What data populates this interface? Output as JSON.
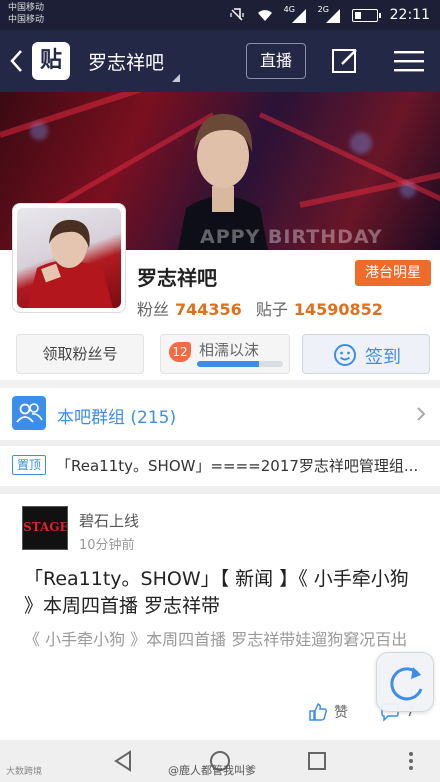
{
  "status_bar": {
    "carrier_line1": "中国移动",
    "carrier_line2": "中国移动",
    "network_1": "4G",
    "network_2": "2G",
    "time": "22:11",
    "battery_level": 0.3
  },
  "nav": {
    "logo_text": "贴",
    "forum_title": "罗志祥吧",
    "live_label": "直播"
  },
  "banner": {
    "overlay_text": "APPY BIRTHDAY"
  },
  "forum": {
    "name": "罗志祥吧",
    "category": "港台明星",
    "fans_label": "粉丝",
    "fans_count": "744356",
    "posts_label": "贴子",
    "posts_count": "14590852"
  },
  "actions": {
    "fans_badge_label": "领取粉丝号",
    "level_number": "12",
    "level_name": "相濡以沫",
    "level_progress": 0.72,
    "sign_label": "签到"
  },
  "group": {
    "label": "本吧群组 (215)"
  },
  "pinned": {
    "badge": "置顶",
    "title": "「Rea11ty。SHOW」====2017罗志祥吧管理组..."
  },
  "post": {
    "avatar_text": "STAGE",
    "author": "碧石上线",
    "time": "10分钟前",
    "title": "「Rea11ty。SHOW」【 新闻 】《 小手牵小狗 》本周四首播 罗志祥带",
    "excerpt": "《 小手牵小狗 》本周四首播 罗志祥带娃遛狗窘况百出",
    "like_label": "赞",
    "comment_count": "7"
  },
  "watermarks": {
    "left": "大数跨境",
    "right": "@鹿人都管我叫爹"
  },
  "colors": {
    "nav_bg": "#242847",
    "accent": "#3d8eeb",
    "orange": "#e0701e",
    "badge": "#f06a2a"
  }
}
